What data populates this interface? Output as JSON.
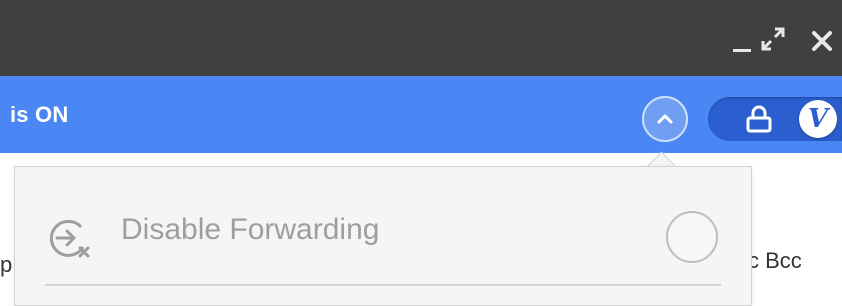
{
  "window": {
    "controls": [
      {
        "name": "minimize",
        "icon": "minimize-icon"
      },
      {
        "name": "maximize",
        "icon": "expand-icon"
      },
      {
        "name": "close",
        "icon": "close-icon"
      }
    ]
  },
  "banner": {
    "status_text": "is ON",
    "collapse_icon": "chevron-up-icon",
    "toggle": {
      "state": "on",
      "lock_icon": "lock-icon",
      "brand_letter": "V"
    }
  },
  "background": {
    "left_fragment": "p",
    "right_text": "c  Bcc"
  },
  "dropdown": {
    "items": [
      {
        "label": "Disable Forwarding",
        "icon": "disable-forwarding-icon",
        "selected": false
      }
    ]
  },
  "colors": {
    "titlebar": "#404040",
    "banner": "#4a86f4",
    "toggle": "#2b5fcf",
    "dropdown_bg": "#f5f5f5",
    "muted_text": "#9e9e9e"
  }
}
